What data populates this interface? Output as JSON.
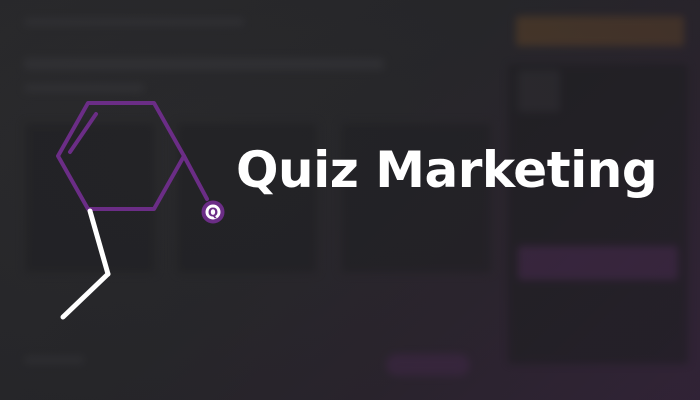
{
  "brand": {
    "title": "Quiz Marketing",
    "logo_letter": "Q",
    "logo_icon": "molecule-ring-icon",
    "accent_color": "#6b2d86",
    "line_color": "#ffffff"
  },
  "background": {
    "description_free": true,
    "gradient_colors": [
      "#2b2b2d",
      "#3a2540"
    ]
  }
}
